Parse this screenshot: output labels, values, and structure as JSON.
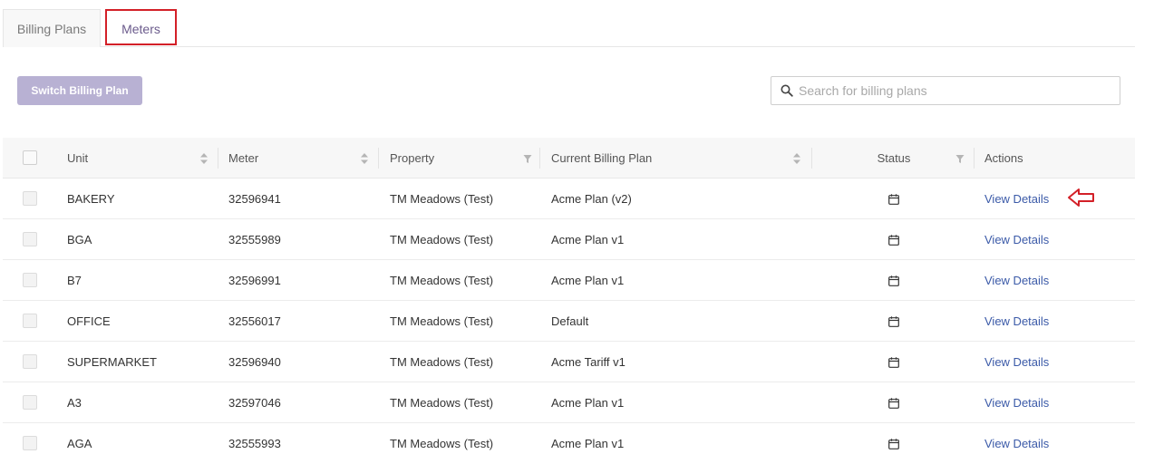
{
  "tabs": [
    {
      "label": "Billing Plans"
    },
    {
      "label": "Meters"
    }
  ],
  "toolbar": {
    "switch_label": "Switch Billing Plan"
  },
  "search": {
    "placeholder": "Search for billing plans",
    "value": "",
    "icon": "search-icon"
  },
  "table": {
    "headers": {
      "unit": "Unit",
      "meter": "Meter",
      "property": "Property",
      "plan": "Current Billing Plan",
      "status": "Status",
      "actions": "Actions"
    },
    "rows": [
      {
        "unit": "BAKERY",
        "meter": "32596941",
        "property": "TM Meadows (Test)",
        "plan": "Acme Plan (v2)",
        "action": "View Details"
      },
      {
        "unit": "BGA",
        "meter": "32555989",
        "property": "TM Meadows (Test)",
        "plan": "Acme Plan v1",
        "action": "View Details"
      },
      {
        "unit": "B7",
        "meter": "32596991",
        "property": "TM Meadows (Test)",
        "plan": "Acme Plan v1",
        "action": "View Details"
      },
      {
        "unit": "OFFICE",
        "meter": "32556017",
        "property": "TM Meadows (Test)",
        "plan": "Default",
        "action": "View Details"
      },
      {
        "unit": "SUPERMARKET",
        "meter": "32596940",
        "property": "TM Meadows (Test)",
        "plan": "Acme Tariff v1",
        "action": "View Details"
      },
      {
        "unit": "A3",
        "meter": "32597046",
        "property": "TM Meadows (Test)",
        "plan": "Acme Plan v1",
        "action": "View Details"
      },
      {
        "unit": "AGA",
        "meter": "32555993",
        "property": "TM Meadows (Test)",
        "plan": "Acme Plan v1",
        "action": "View Details"
      }
    ]
  },
  "colors": {
    "accent": "#6b5b8c",
    "highlight": "#d32028",
    "link": "#3b5aa8",
    "button": "#b8b1d3"
  }
}
